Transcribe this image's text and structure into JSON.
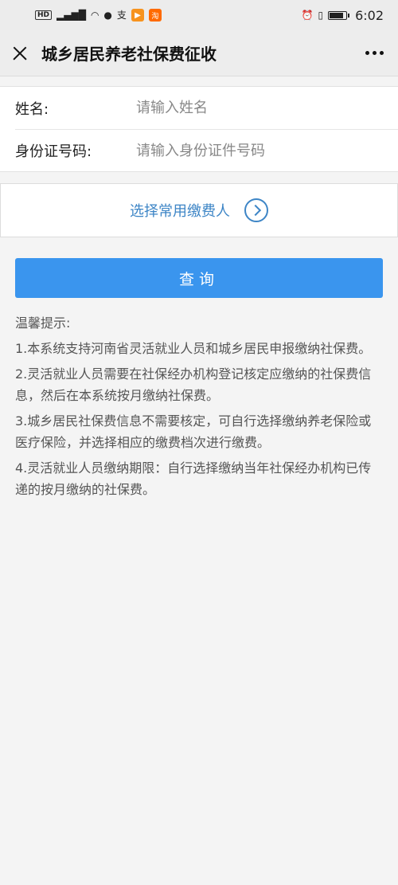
{
  "status_bar": {
    "left_icons": [
      "HD",
      "4G",
      "signal",
      "wifi",
      "chat",
      "alipay",
      "app-orange",
      "taobao"
    ],
    "time": "6:02"
  },
  "nav": {
    "title": "城乡居民养老社保费征收"
  },
  "form": {
    "name_label": "姓名:",
    "name_placeholder": "请输入姓名",
    "id_label": "身份证号码:",
    "id_placeholder": "请输入身份证件号码"
  },
  "payer": {
    "label": "选择常用缴费人"
  },
  "query_button": "查询",
  "tips": {
    "title": "温馨提示:",
    "items": [
      "1.本系统支持河南省灵活就业人员和城乡居民申报缴纳社保费。",
      "2.灵活就业人员需要在社保经办机构登记核定应缴纳的社保费信息，然后在本系统按月缴纳社保费。",
      "3.城乡居民社保费信息不需要核定，可自行选择缴纳养老保险或医疗保险，并选择相应的缴费档次进行缴费。",
      "4.灵活就业人员缴纳期限：自行选择缴纳当年社保经办机构已传递的按月缴纳的社保费。"
    ]
  },
  "colors": {
    "accent": "#3a95ee",
    "link": "#3d85c6"
  }
}
